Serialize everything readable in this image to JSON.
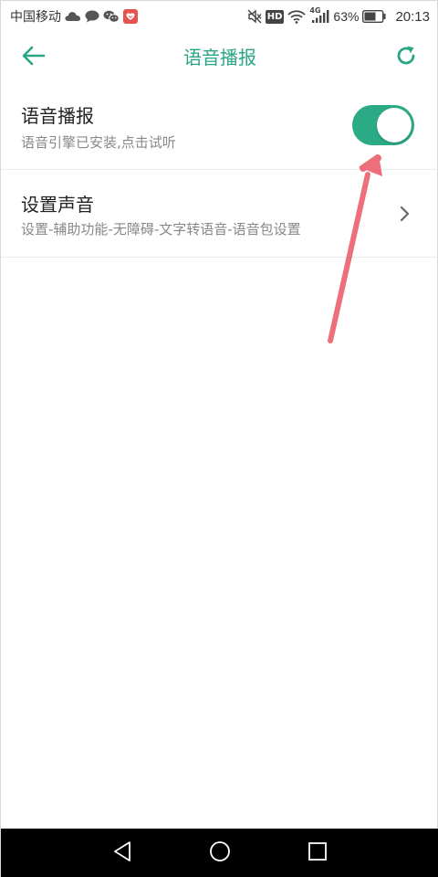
{
  "status_bar": {
    "carrier": "中国移动",
    "network_badge": "HD",
    "network_type": "4G",
    "battery_percent": "63%",
    "time": "20:13",
    "left_icons": [
      "cloud-icon",
      "chat-bubble-icon",
      "wechat-icon",
      "app-badge-icon"
    ],
    "right_icons": [
      "mute-icon",
      "hd-icon",
      "wifi-icon",
      "signal-icon",
      "battery-icon"
    ]
  },
  "toolbar": {
    "title": "语音播报",
    "back_icon": "arrow-left-icon",
    "refresh_icon": "refresh-icon"
  },
  "settings": {
    "voice_broadcast": {
      "title": "语音播报",
      "subtitle": "语音引擎已安装,点击试听",
      "enabled": true
    },
    "set_sound": {
      "title": "设置声音",
      "subtitle": "设置-辅助功能-无障碍-文字转语音-语音包设置",
      "icon": "chevron-right-icon"
    }
  },
  "nav_bar": {
    "icons": [
      "triangle-back-icon",
      "circle-home-icon",
      "square-recent-icon"
    ]
  },
  "colors": {
    "accent": "#2aa585",
    "toggle_on": "#2aab86",
    "annotation_arrow": "#ec6f7b",
    "nav_bar": "#000000"
  }
}
